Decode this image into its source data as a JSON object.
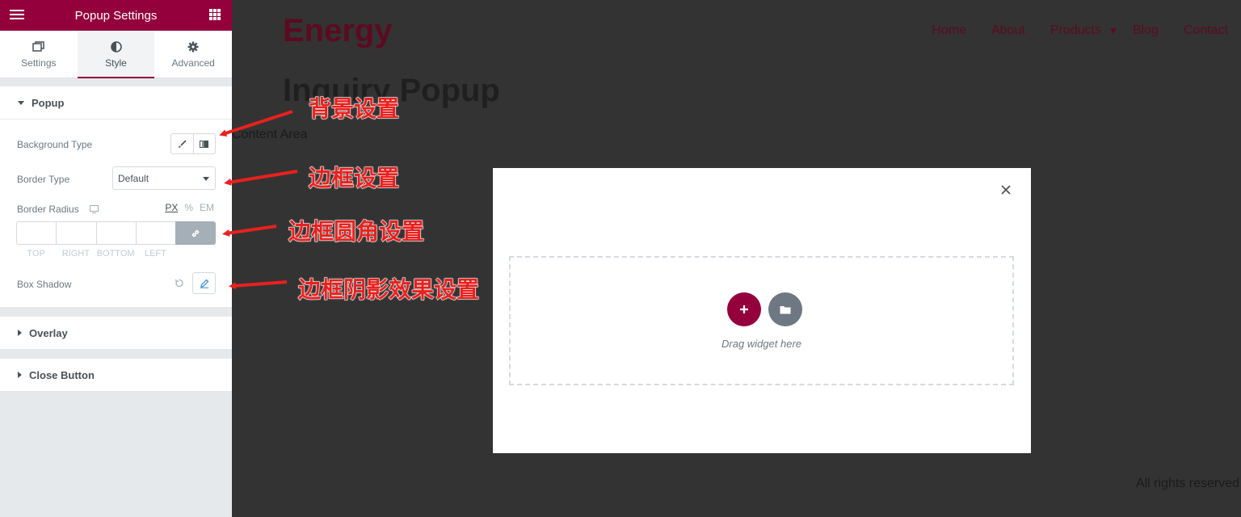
{
  "panel": {
    "title": "Popup Settings",
    "tabs": [
      {
        "label": "Settings",
        "icon": "window-icon"
      },
      {
        "label": "Style",
        "icon": "half-circle-icon"
      },
      {
        "label": "Advanced",
        "icon": "gear-icon"
      }
    ],
    "active_tab": "Style",
    "accent_color": "#93003c"
  },
  "popup_section": {
    "title": "Popup",
    "background_type_label": "Background Type",
    "border_type_label": "Border Type",
    "border_type_value": "Default",
    "border_radius_label": "Border Radius",
    "units": [
      "PX",
      "%",
      "EM"
    ],
    "active_unit": "PX",
    "dimension_labels": [
      "TOP",
      "RIGHT",
      "BOTTOM",
      "LEFT"
    ],
    "box_shadow_label": "Box Shadow"
  },
  "sections": {
    "overlay": "Overlay",
    "close_button": "Close Button"
  },
  "preview": {
    "site_title": "Energy",
    "nav": [
      "Home",
      "About",
      "Products",
      "Blog",
      "Contact"
    ],
    "page_title": "Inquiry Popup",
    "content_area": "Content Area",
    "footer": "All rights reserved",
    "drag_text": "Drag widget here"
  },
  "annotations": {
    "background": "背景设置",
    "border": "边框设置",
    "border_radius": "边框圆角设置",
    "box_shadow": "边框阴影效果设置",
    "color": "#e8211e"
  }
}
